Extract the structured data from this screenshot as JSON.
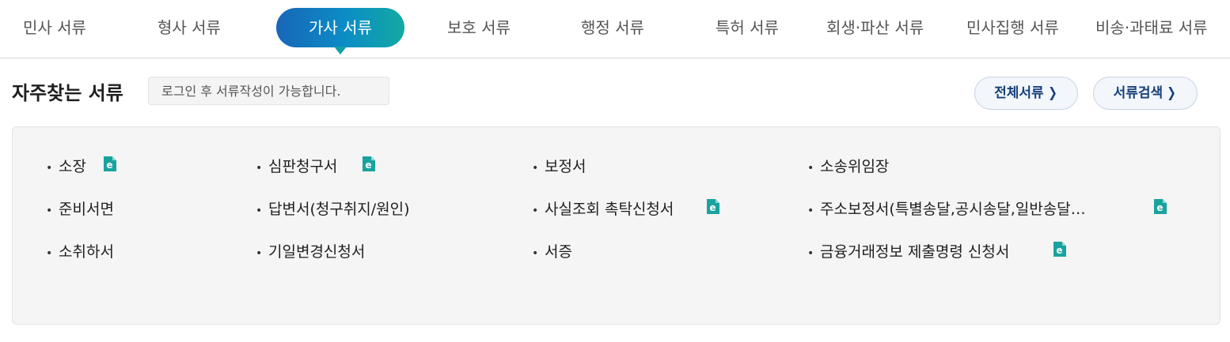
{
  "tabs": [
    {
      "label": "민사 서류",
      "active": false
    },
    {
      "label": "형사 서류",
      "active": false
    },
    {
      "label": "가사 서류",
      "active": true
    },
    {
      "label": "보호 서류",
      "active": false
    },
    {
      "label": "행정 서류",
      "active": false
    },
    {
      "label": "특허 서류",
      "active": false
    },
    {
      "label": "회생·파산 서류",
      "active": false
    },
    {
      "label": "민사집행 서류",
      "active": false
    },
    {
      "label": "비송·과태료 서류",
      "active": false
    }
  ],
  "section": {
    "title": "자주찾는 서류",
    "login_note": "로그인 후 서류작성이 가능합니다."
  },
  "buttons": {
    "all_docs": "전체서류",
    "search_docs": "서류검색",
    "chevron": "❯"
  },
  "documents": [
    {
      "label": "소장",
      "e_form": true
    },
    {
      "label": "심판청구서",
      "e_form": true
    },
    {
      "label": "보정서",
      "e_form": false
    },
    {
      "label": "소송위임장",
      "e_form": false
    },
    {
      "label": "준비서면",
      "e_form": false
    },
    {
      "label": "답변서(청구취지/원인)",
      "e_form": false
    },
    {
      "label": "사실조회 촉탁신청서",
      "e_form": true
    },
    {
      "label": "주소보정서(특별송달,공시송달,일반송달…",
      "e_form": true
    },
    {
      "label": "소취하서",
      "e_form": false
    },
    {
      "label": "기일변경신청서",
      "e_form": false
    },
    {
      "label": "서증",
      "e_form": false
    },
    {
      "label": "금융거래정보 제출명령 신청서",
      "e_form": true
    }
  ],
  "bullet": "•",
  "colors": {
    "active_tab_gradient": [
      "#1866b8",
      "#0b8ec5",
      "#13a9a3"
    ],
    "e_icon": "#1aa39e",
    "button_text": "#16407a"
  },
  "icons": {
    "e_form_icon": "electronic-form-icon",
    "chevron": "chevron-right-icon"
  }
}
